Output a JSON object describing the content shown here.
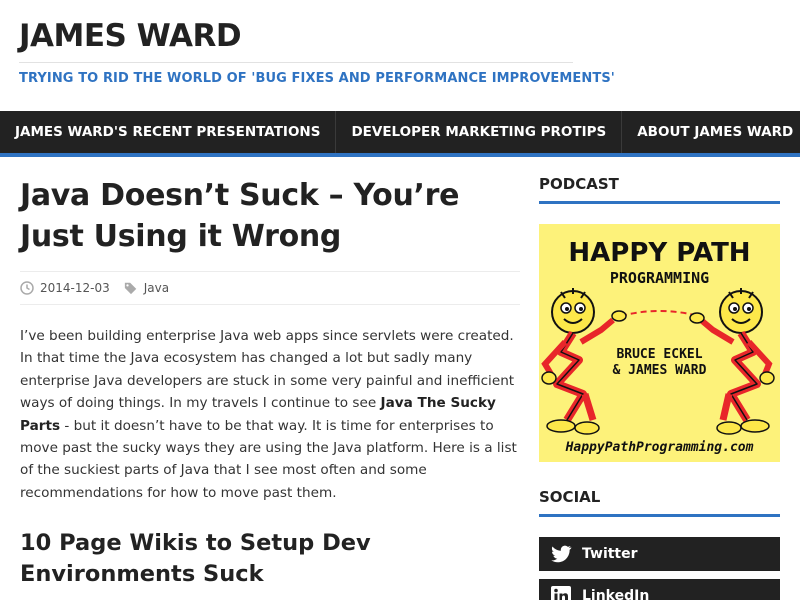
{
  "site": {
    "title": "JAMES WARD",
    "description": "TRYING TO RID THE WORLD OF 'BUG FIXES AND PERFORMANCE IMPROVEMENTS'"
  },
  "nav": {
    "items": [
      {
        "label": "JAMES WARD'S RECENT PRESENTATIONS"
      },
      {
        "label": "DEVELOPER MARKETING PROTIPS"
      },
      {
        "label": "ABOUT JAMES WARD"
      }
    ]
  },
  "post": {
    "title": "Java Doesn’t Suck – You’re Just Using it Wrong",
    "date": "2014-12-03",
    "category": "Java",
    "body_part1": "I’ve been building enterprise Java web apps since servlets were created. In that time the Java ecosystem has changed a lot but sadly many enterprise Java developers are stuck in some very painful and inefficient ways of doing things. In my travels I continue to see ",
    "body_strong": "Java The Sucky Parts",
    "body_part2": " - but it doesn’t have to be that way. It is time for enterprises to move past the sucky ways they are using the Java platform. Here is a list of the suckiest parts of Java that I see most often and some recommendations for how to move past them.",
    "section1_heading": "10 Page Wikis to Setup Dev Environments Suck"
  },
  "sidebar": {
    "podcast_title": "PODCAST",
    "podcast_image": {
      "line1": "HAPPY PATH",
      "line2": "PROGRAMMING",
      "hosts1": "BRUCE ECKEL",
      "hosts2": "& JAMES WARD",
      "url": "HappyPathProgramming.com"
    },
    "social_title": "SOCIAL",
    "social": [
      {
        "label": "Twitter",
        "icon": "twitter-icon"
      },
      {
        "label": "LinkedIn",
        "icon": "linkedin-icon"
      }
    ]
  },
  "colors": {
    "accent": "#2f73c2",
    "nav_bg": "#222222",
    "podcast_bg": "#fdf27a",
    "podcast_figure": "#e8262a"
  }
}
